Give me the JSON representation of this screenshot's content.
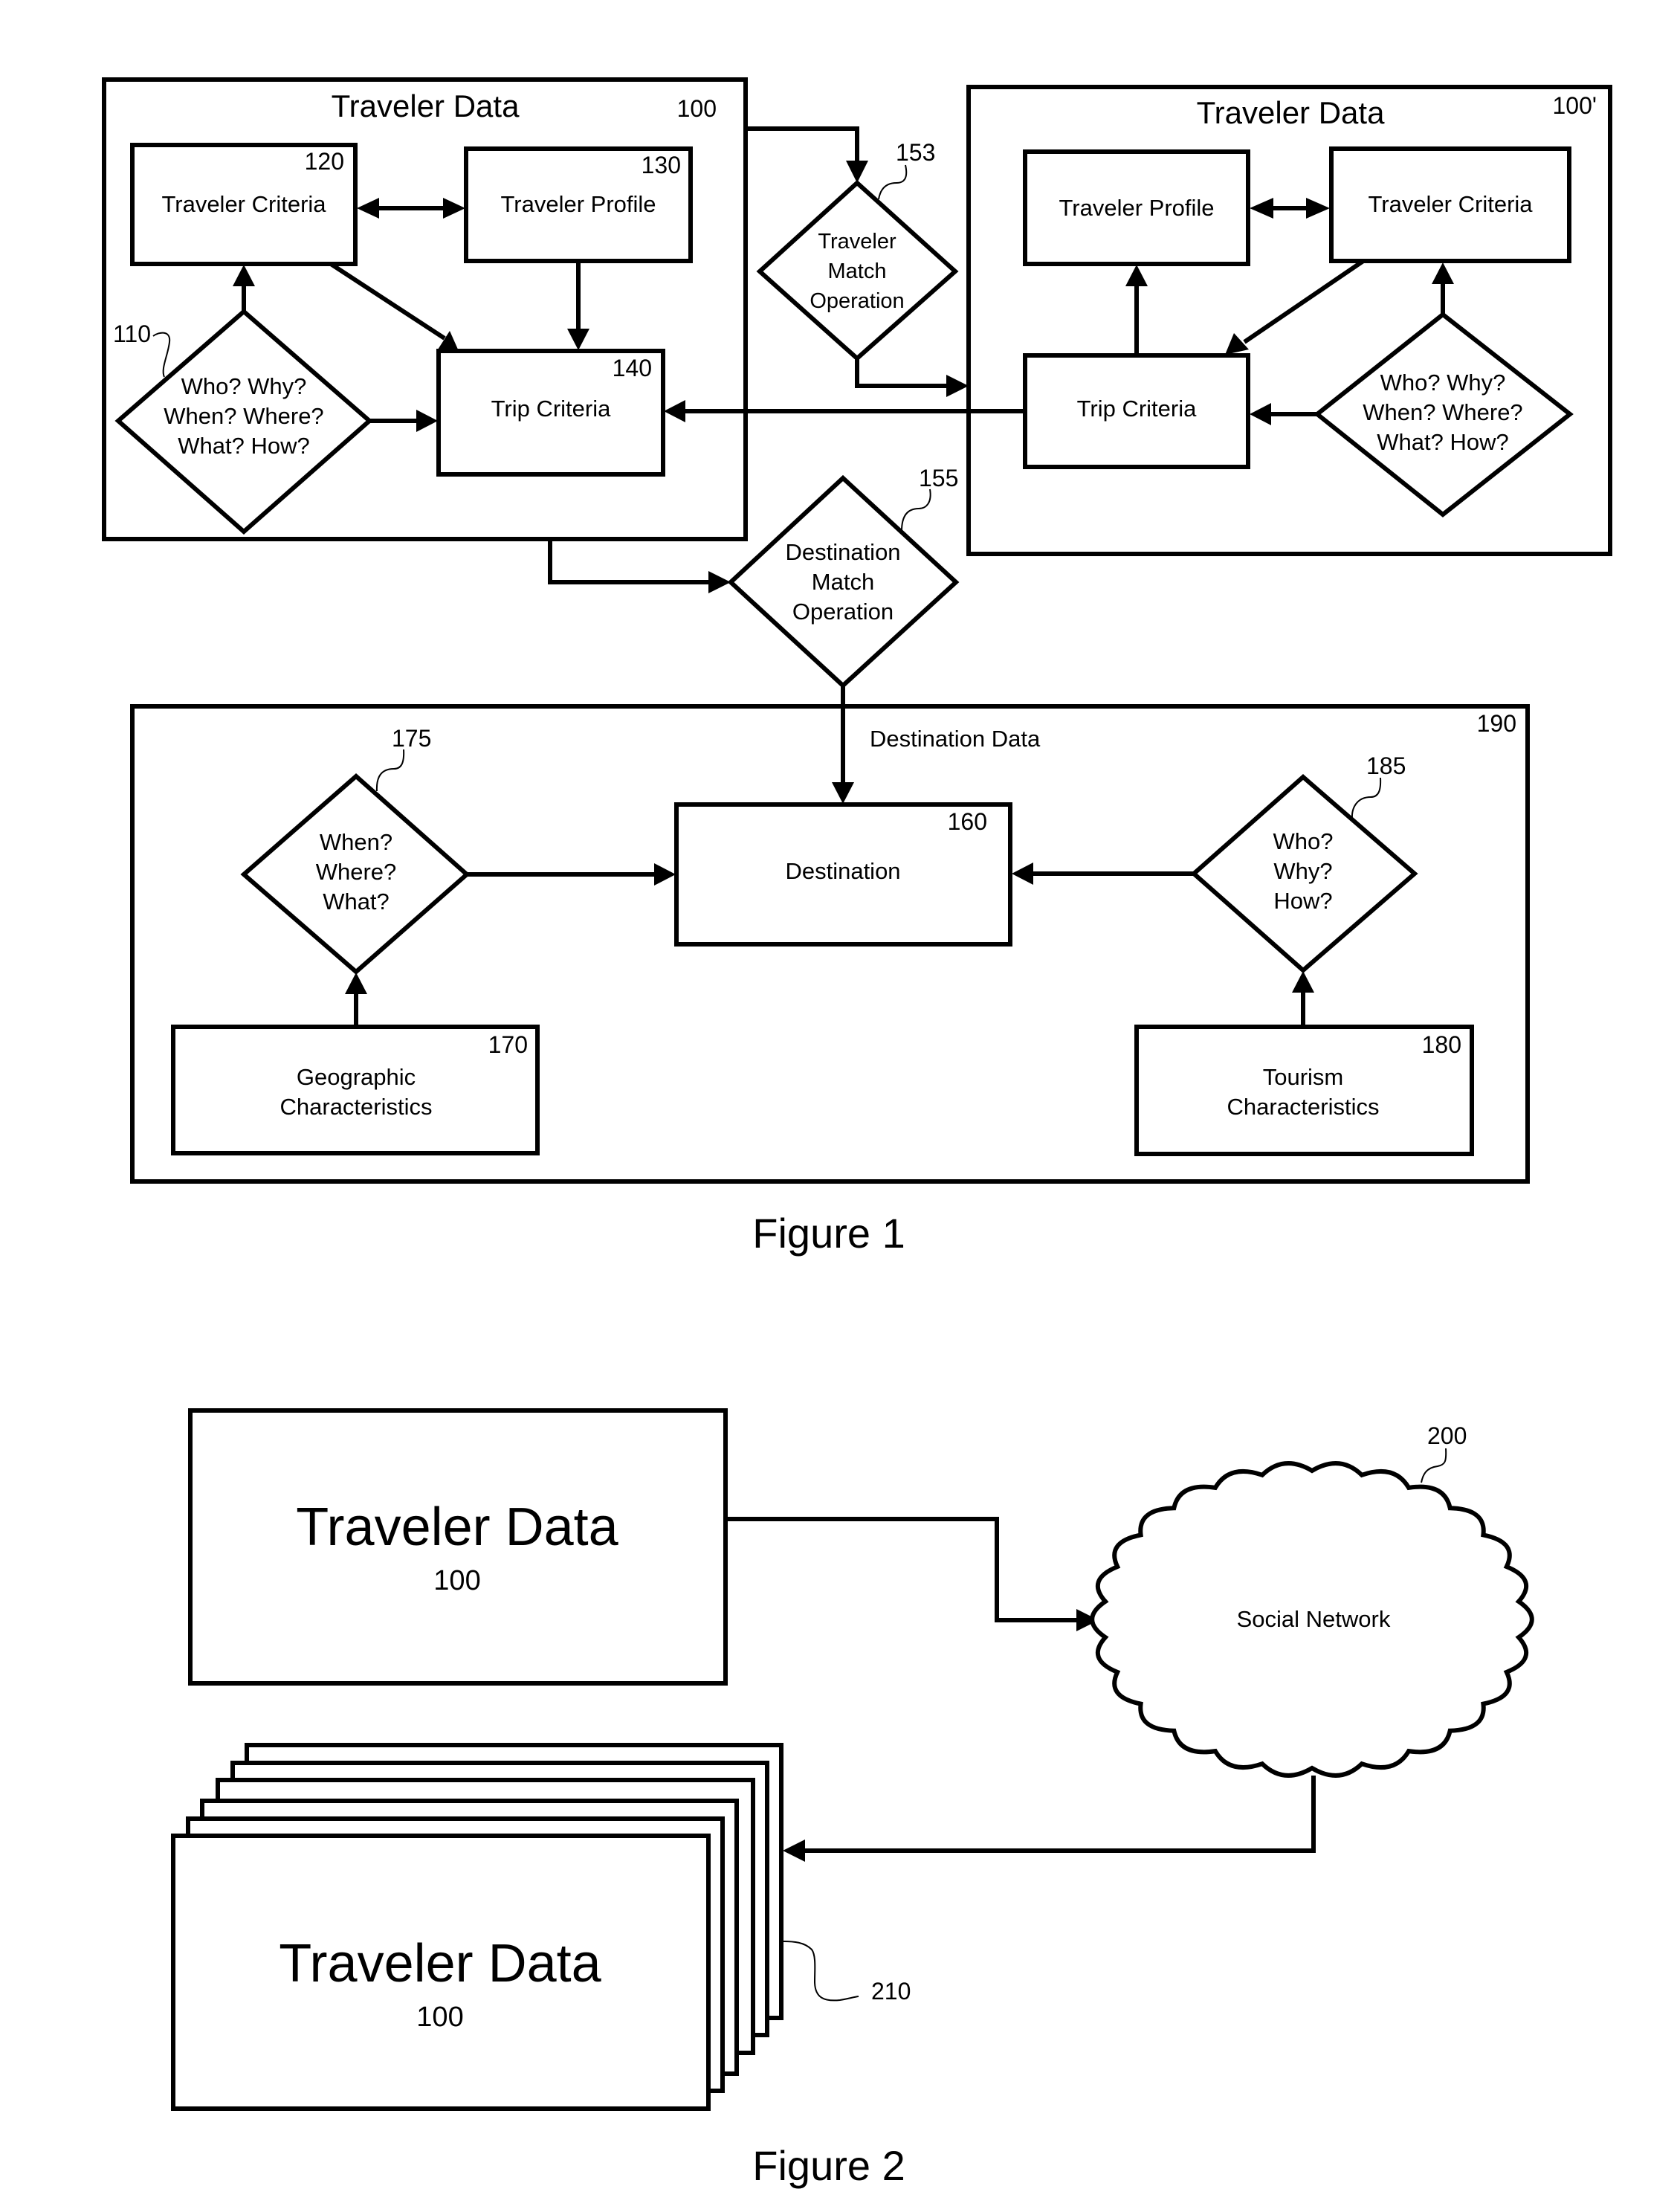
{
  "figure1": {
    "caption": "Figure 1",
    "traveler_data_a": {
      "title": "Traveler Data",
      "ref": "100",
      "traveler_criteria": {
        "label": "Traveler Criteria",
        "ref": "120"
      },
      "traveler_profile": {
        "label": "Traveler Profile",
        "ref": "130"
      },
      "trip_criteria": {
        "label": "Trip Criteria",
        "ref": "140"
      },
      "questions": {
        "ref": "110",
        "lines": [
          "Who? Why?",
          "When? Where?",
          "What? How?"
        ]
      }
    },
    "traveler_data_b": {
      "title": "Traveler Data",
      "ref": "100'",
      "traveler_profile": {
        "label": "Traveler Profile"
      },
      "traveler_criteria": {
        "label": "Traveler Criteria"
      },
      "trip_criteria": {
        "label": "Trip Criteria"
      },
      "questions": {
        "lines": [
          "Who? Why?",
          "When? Where?",
          "What? How?"
        ]
      }
    },
    "traveler_match": {
      "ref": "153",
      "lines": [
        "Traveler",
        "Match",
        "Operation"
      ]
    },
    "destination_match": {
      "ref": "155",
      "lines": [
        "Destination",
        "Match",
        "Operation"
      ]
    },
    "destination_data": {
      "title": "Destination Data",
      "ref": "190",
      "destination": {
        "label": "Destination",
        "ref": "160"
      },
      "geo_questions": {
        "ref": "175",
        "lines": [
          "When?",
          "Where?",
          "What?"
        ]
      },
      "tourism_questions": {
        "ref": "185",
        "lines": [
          "Who?",
          "Why?",
          "How?"
        ]
      },
      "geographic": {
        "ref": "170",
        "lines": [
          "Geographic",
          "Characteristics"
        ]
      },
      "tourism": {
        "ref": "180",
        "lines": [
          "Tourism",
          "Characteristics"
        ]
      }
    }
  },
  "figure2": {
    "caption": "Figure 2",
    "traveler_data": {
      "title": "Traveler Data",
      "ref": "100"
    },
    "social_network": {
      "label": "Social Network",
      "ref": "200"
    },
    "traveler_data_stack": {
      "title": "Traveler Data",
      "ref": "100",
      "stack_ref": "210",
      "layers": 6
    }
  }
}
